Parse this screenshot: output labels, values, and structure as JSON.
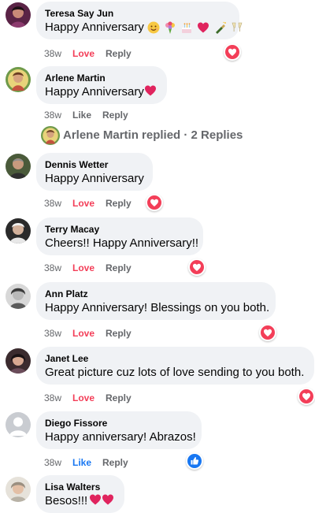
{
  "comments": [
    {
      "name": "Teresa Say Jun",
      "text": "Happy Anniversary",
      "age": "38w",
      "action": "Love",
      "reply": "Reply",
      "reaction": "love",
      "emojis": [
        "smile-emoji",
        "bouquet-emoji",
        "cake-emoji",
        "heart-emoji",
        "champagne-emoji",
        "toast-emoji"
      ]
    },
    {
      "name": "Arlene Martin",
      "text": "Happy Anniversary",
      "age": "38w",
      "action": "Like",
      "reply": "Reply",
      "reaction": "",
      "emojis": [
        "heart-emoji"
      ]
    },
    {
      "name": "Dennis Wetter",
      "text": "Happy Anniversary",
      "age": "38w",
      "action": "Love",
      "reply": "Reply",
      "reaction": "love"
    },
    {
      "name": "Terry Macay",
      "text": "Cheers!! Happy Anniversary!!",
      "age": "38w",
      "action": "Love",
      "reply": "Reply",
      "reaction": "love"
    },
    {
      "name": "Ann Platz",
      "text": "Happy Anniversary! Blessings on you both.",
      "age": "38w",
      "action": "Love",
      "reply": "Reply",
      "reaction": "love"
    },
    {
      "name": "Janet Lee",
      "text": "Great picture cuz lots of love sending to you both.",
      "age": "38w",
      "action": "Love",
      "reply": "Reply",
      "reaction": "love"
    },
    {
      "name": "Diego Fissore",
      "text": "Happy anniversary! Abrazos!",
      "age": "38w",
      "action": "Like",
      "reply": "Reply",
      "reaction": "like"
    },
    {
      "name": "Lisa Walters",
      "text": "Besos!!!",
      "age": "",
      "action": "",
      "reply": "",
      "reaction": "",
      "emojis": [
        "heart-emoji",
        "heart-emoji"
      ]
    }
  ],
  "replies_thread": {
    "text": "Arlene Martin replied · 2 Replies"
  },
  "colors": {
    "love": "#f33e58",
    "like": "#1877f2",
    "meta": "#65676b",
    "bubble": "#f0f2f5"
  }
}
